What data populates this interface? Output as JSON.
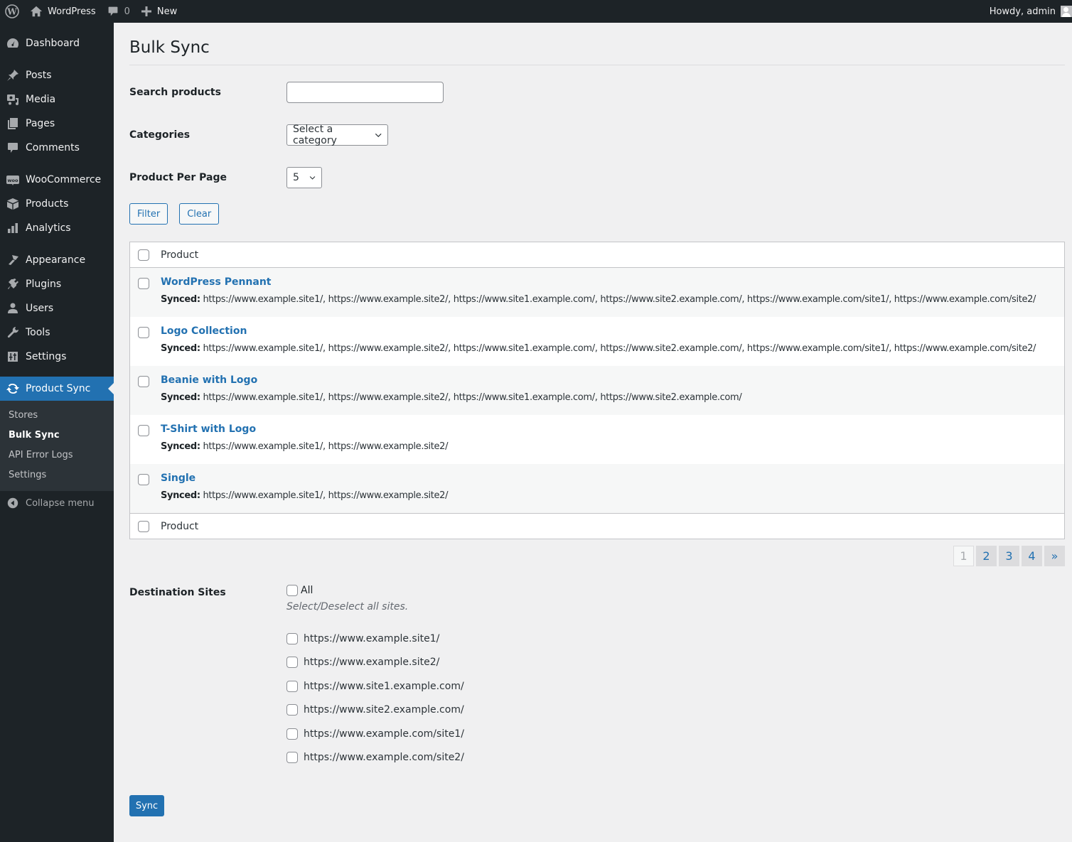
{
  "adminbar": {
    "site_name": "WordPress",
    "comments_count": "0",
    "new_label": "New",
    "howdy": "Howdy, admin"
  },
  "sidebar": {
    "items": [
      {
        "label": "Dashboard",
        "icon": "dashboard-icon"
      },
      {
        "label": "Posts",
        "icon": "pin-icon"
      },
      {
        "label": "Media",
        "icon": "media-icon"
      },
      {
        "label": "Pages",
        "icon": "pages-icon"
      },
      {
        "label": "Comments",
        "icon": "comment-icon"
      },
      {
        "label": "WooCommerce",
        "icon": "woo-icon"
      },
      {
        "label": "Products",
        "icon": "box-icon"
      },
      {
        "label": "Analytics",
        "icon": "bar-chart-icon"
      },
      {
        "label": "Appearance",
        "icon": "brush-icon"
      },
      {
        "label": "Plugins",
        "icon": "plug-icon"
      },
      {
        "label": "Users",
        "icon": "user-icon"
      },
      {
        "label": "Tools",
        "icon": "wrench-icon"
      },
      {
        "label": "Settings",
        "icon": "sliders-icon"
      },
      {
        "label": "Product Sync",
        "icon": "sync-icon"
      }
    ],
    "submenu": [
      "Stores",
      "Bulk Sync",
      "API Error Logs",
      "Settings"
    ],
    "collapse_label": "Collapse menu"
  },
  "page": {
    "title": "Bulk Sync",
    "search_label": "Search products",
    "search_value": "",
    "categories_label": "Categories",
    "categories_selected": "Select a category",
    "per_page_label": "Product Per Page",
    "per_page_selected": "5",
    "filter_label": "Filter",
    "clear_label": "Clear"
  },
  "table": {
    "header": "Product",
    "footer": "Product",
    "synced_label": "Synced:",
    "rows": [
      {
        "name": "WordPress Pennant",
        "synced": "https://www.example.site1/, https://www.example.site2/, https://www.site1.example.com/, https://www.site2.example.com/, https://www.example.com/site1/, https://www.example.com/site2/"
      },
      {
        "name": "Logo Collection",
        "synced": "https://www.example.site1/, https://www.example.site2/, https://www.site1.example.com/, https://www.site2.example.com/, https://www.example.com/site1/, https://www.example.com/site2/"
      },
      {
        "name": "Beanie with Logo",
        "synced": "https://www.example.site1/, https://www.example.site2/, https://www.site1.example.com/, https://www.site2.example.com/"
      },
      {
        "name": "T-Shirt with Logo",
        "synced": "https://www.example.site1/, https://www.example.site2/"
      },
      {
        "name": "Single",
        "synced": "https://www.example.site1/, https://www.example.site2/"
      }
    ]
  },
  "pagination": {
    "pages": [
      "1",
      "2",
      "3",
      "4"
    ],
    "current": "1",
    "next": "»"
  },
  "destination": {
    "label": "Destination Sites",
    "all_label": "All",
    "hint": "Select/Deselect all sites.",
    "sites": [
      "https://www.example.site1/",
      "https://www.example.site2/",
      "https://www.site1.example.com/",
      "https://www.site2.example.com/",
      "https://www.example.com/site1/",
      "https://www.example.com/site2/"
    ]
  },
  "sync_label": "Sync"
}
